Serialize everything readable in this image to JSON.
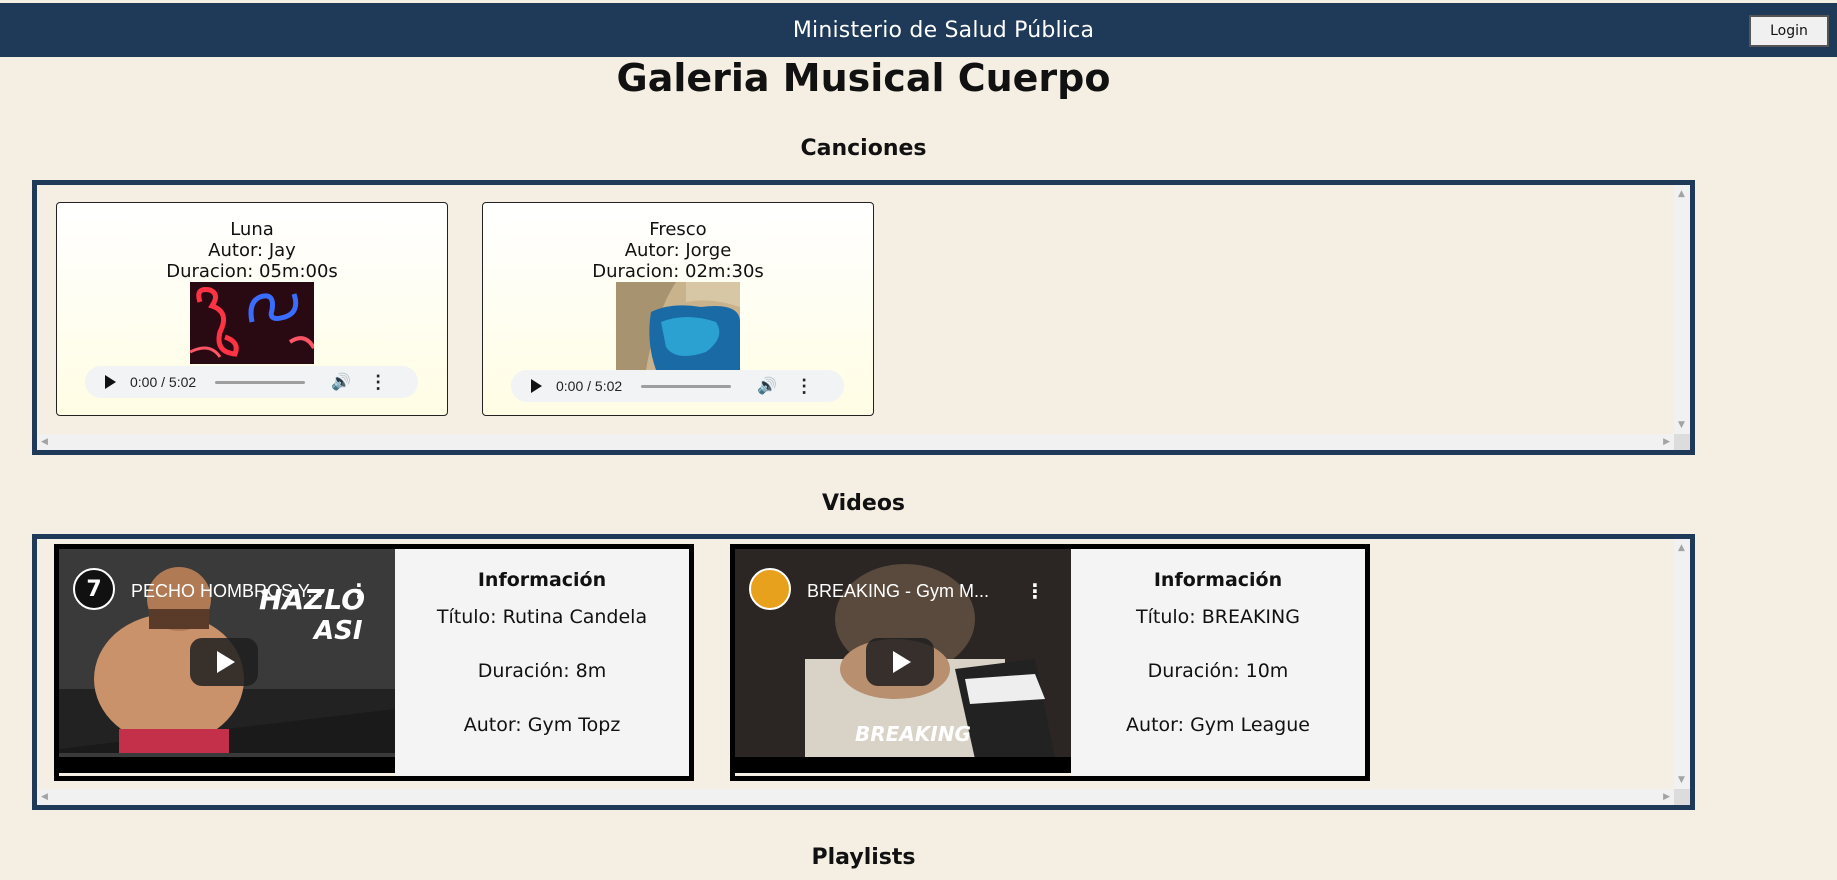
{
  "header": {
    "site_title": "Ministerio de Salud Pública",
    "login_label": "Login"
  },
  "page": {
    "title": "Galeria Musical Cuerpo"
  },
  "sections": {
    "songs": "Canciones",
    "videos": "Videos",
    "playlists": "Playlists"
  },
  "songs": [
    {
      "title": "Luna",
      "author": "Autor: Jay",
      "duration": "Duracion: 05m:00s",
      "player_time": "0:00 / 5:02"
    },
    {
      "title": "Fresco",
      "author": "Autor: Jorge",
      "duration": "Duracion: 02m:30s",
      "player_time": "0:00 / 5:02"
    }
  ],
  "videos": [
    {
      "embed_title": "PECHO HOMBROS Y...",
      "logo_text": "7",
      "overlay_text": "HAZLO ASI",
      "info_heading": "Información",
      "title_line": "Título: Rutina Candela",
      "duration_line": "Duración: 8m",
      "author_line": "Autor: Gym Topz"
    },
    {
      "embed_title": "BREAKING - Gym M...",
      "logo_text": "",
      "overlay_text": "BREAKING",
      "info_heading": "Información",
      "title_line": "Título: BREAKING",
      "duration_line": "Duración: 10m",
      "author_line": "Autor: Gym League"
    }
  ],
  "icons": {
    "play": "play-icon",
    "volume": "volume-icon",
    "more": "more-vertical-icon"
  },
  "colors": {
    "header_bg": "#1f3a58",
    "page_bg": "#f5efe3",
    "panel_border": "#1f3a58"
  }
}
